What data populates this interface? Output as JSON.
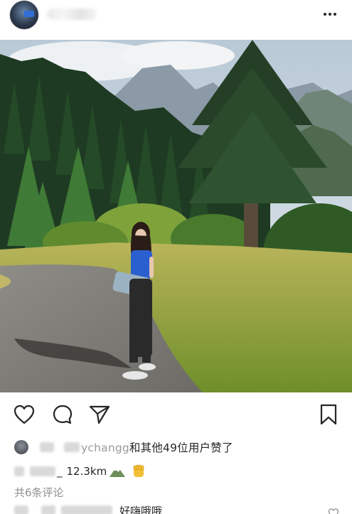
{
  "post": {
    "likes": {
      "username_visible_part": "ychangg",
      "suffix_text": "和其他49位用户赞了"
    },
    "caption": {
      "text": "12.3km",
      "username_visible_part": "_"
    },
    "comments_link": "共6条评论",
    "first_comment": {
      "text": "好嗨哦哦"
    }
  },
  "icons": {
    "header_more": "more-horizontal-icon",
    "like": "heart-icon",
    "comment": "comment-bubble-icon",
    "share": "paper-plane-icon",
    "save": "bookmark-icon",
    "caption_emoji_1": "mountain-emoji",
    "caption_emoji_2": "raised-fist-emoji"
  },
  "colors": {
    "text": "#262626",
    "secondary_text": "#8e8e8e",
    "background": "#ffffff"
  }
}
